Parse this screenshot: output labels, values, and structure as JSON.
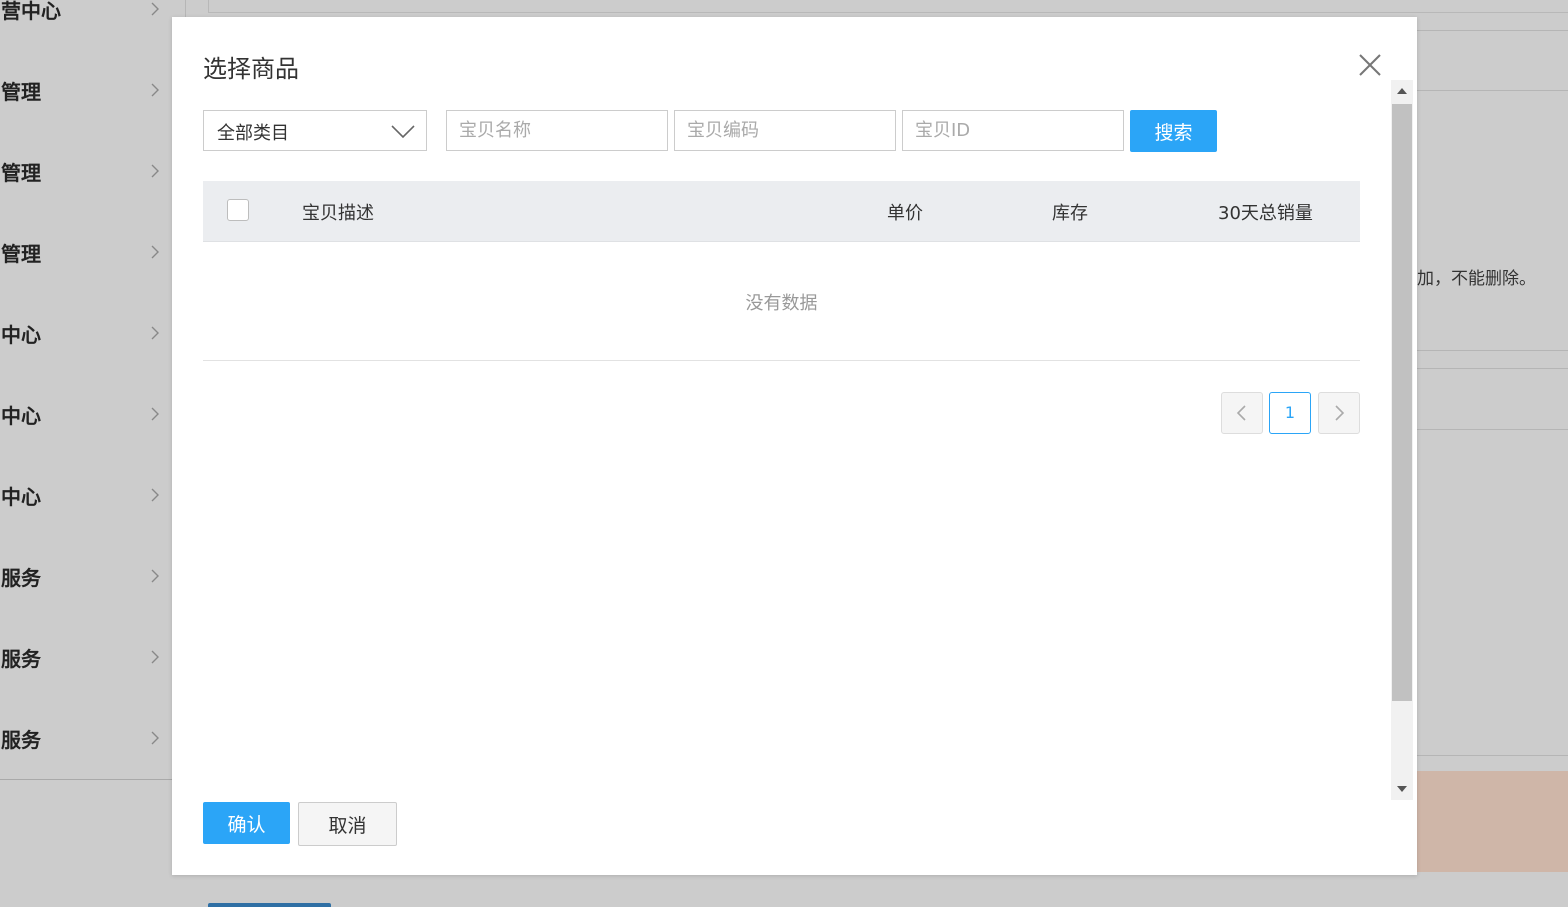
{
  "background": {
    "sidebar_items": [
      {
        "label": "营中心"
      },
      {
        "label": "管理"
      },
      {
        "label": "管理"
      },
      {
        "label": "管理"
      },
      {
        "label": "中心"
      },
      {
        "label": "中心"
      },
      {
        "label": "中心"
      },
      {
        "label": "服务"
      },
      {
        "label": "服务"
      },
      {
        "label": "服务"
      }
    ],
    "right_text": "加，不能删除。",
    "colors": {
      "overlay": "#cccccc",
      "accent_strip": "#cfb6a8"
    }
  },
  "modal": {
    "title": "选择商品",
    "close_icon": "close-icon",
    "filters": {
      "category_selected": "全部类目",
      "name_placeholder": "宝贝名称",
      "code_placeholder": "宝贝编码",
      "id_placeholder": "宝贝ID",
      "search_label": "搜索"
    },
    "table": {
      "columns": [
        "宝贝描述",
        "单价",
        "库存",
        "30天总销量"
      ],
      "rows": [],
      "empty_text": "没有数据"
    },
    "pagination": {
      "current_page": "1"
    },
    "footer": {
      "confirm_label": "确认",
      "cancel_label": "取消"
    },
    "colors": {
      "primary": "#2ba5f7",
      "header_bg": "#ebedf0"
    }
  }
}
